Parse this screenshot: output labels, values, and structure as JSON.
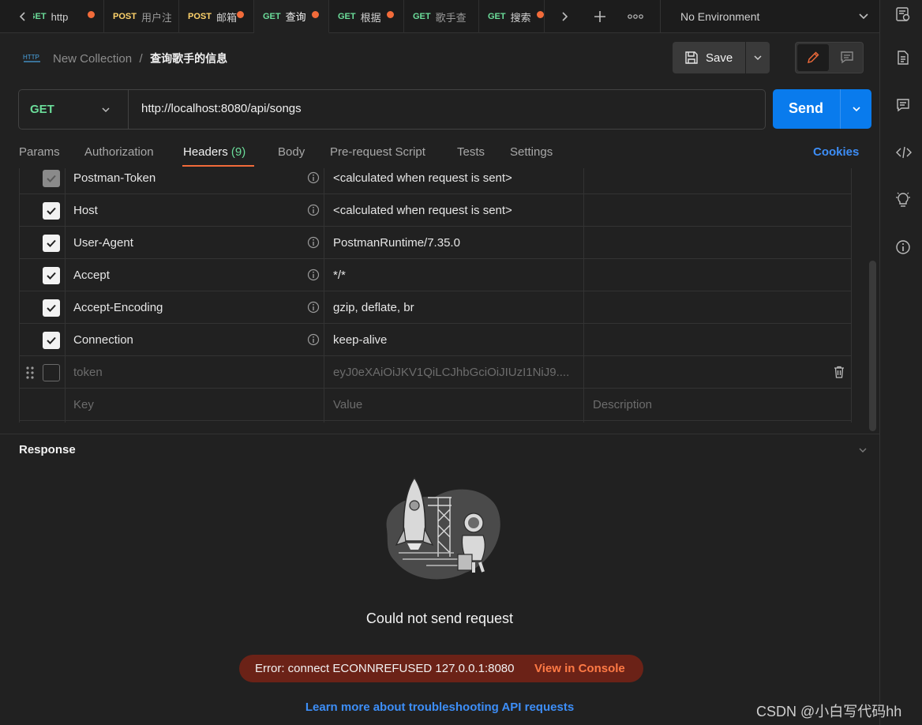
{
  "tabs": [
    {
      "method": "GET",
      "name": "http",
      "unsaved": true
    },
    {
      "method": "POST",
      "name": "用户注",
      "unsaved": false
    },
    {
      "method": "POST",
      "name": "邮箱",
      "unsaved": true
    },
    {
      "method": "GET",
      "name": "查询",
      "unsaved": true,
      "active": true
    },
    {
      "method": "GET",
      "name": "根据",
      "unsaved": true
    },
    {
      "method": "GET",
      "name": "歌手查",
      "unsaved": false
    },
    {
      "method": "GET",
      "name": "搜索",
      "unsaved": true
    }
  ],
  "environment": {
    "label": "No Environment"
  },
  "breadcrumb": {
    "icon_text": "HTTP",
    "collection": "New Collection",
    "separator": "/",
    "request_name": "查询歌手的信息"
  },
  "toolbar": {
    "save_label": "Save"
  },
  "request": {
    "method": "GET",
    "url": "http://localhost:8080/api/songs",
    "send_label": "Send"
  },
  "request_tabs": [
    {
      "label": "Params"
    },
    {
      "label": "Authorization"
    },
    {
      "label": "Headers",
      "count": "(9)",
      "active": true
    },
    {
      "label": "Body"
    },
    {
      "label": "Pre-request Script"
    },
    {
      "label": "Tests"
    },
    {
      "label": "Settings"
    }
  ],
  "cookies_label": "Cookies",
  "headers": {
    "rows": [
      {
        "key": "Postman-Token",
        "value": "<calculated when request is sent>",
        "checked": true,
        "locked": true
      },
      {
        "key": "Host",
        "value": "<calculated when request is sent>",
        "checked": true
      },
      {
        "key": "User-Agent",
        "value": "PostmanRuntime/7.35.0",
        "checked": true
      },
      {
        "key": "Accept",
        "value": "*/*",
        "checked": true
      },
      {
        "key": "Accept-Encoding",
        "value": "gzip, deflate, br",
        "checked": true
      },
      {
        "key": "Connection",
        "value": "keep-alive",
        "checked": true
      },
      {
        "key": "token",
        "value": "eyJ0eXAiOiJKV1QiLCJhbGciOiJIUzI1NiJ9....",
        "checked": false
      }
    ],
    "placeholders": {
      "key": "Key",
      "value": "Value",
      "description": "Description"
    }
  },
  "response": {
    "title": "Response",
    "message": "Could not send request",
    "error_text": "Error: connect ECONNREFUSED 127.0.0.1:8080",
    "console_link": "View in Console",
    "help_link": "Learn more about troubleshooting API requests"
  },
  "watermark": "CSDN @小白写代码hh",
  "colors": {
    "accent": "#f26b3a",
    "send": "#097bed",
    "get": "#6bdd9a",
    "post": "#ffd36b",
    "link": "#3d8ef7",
    "error_bg": "#6b2217"
  }
}
